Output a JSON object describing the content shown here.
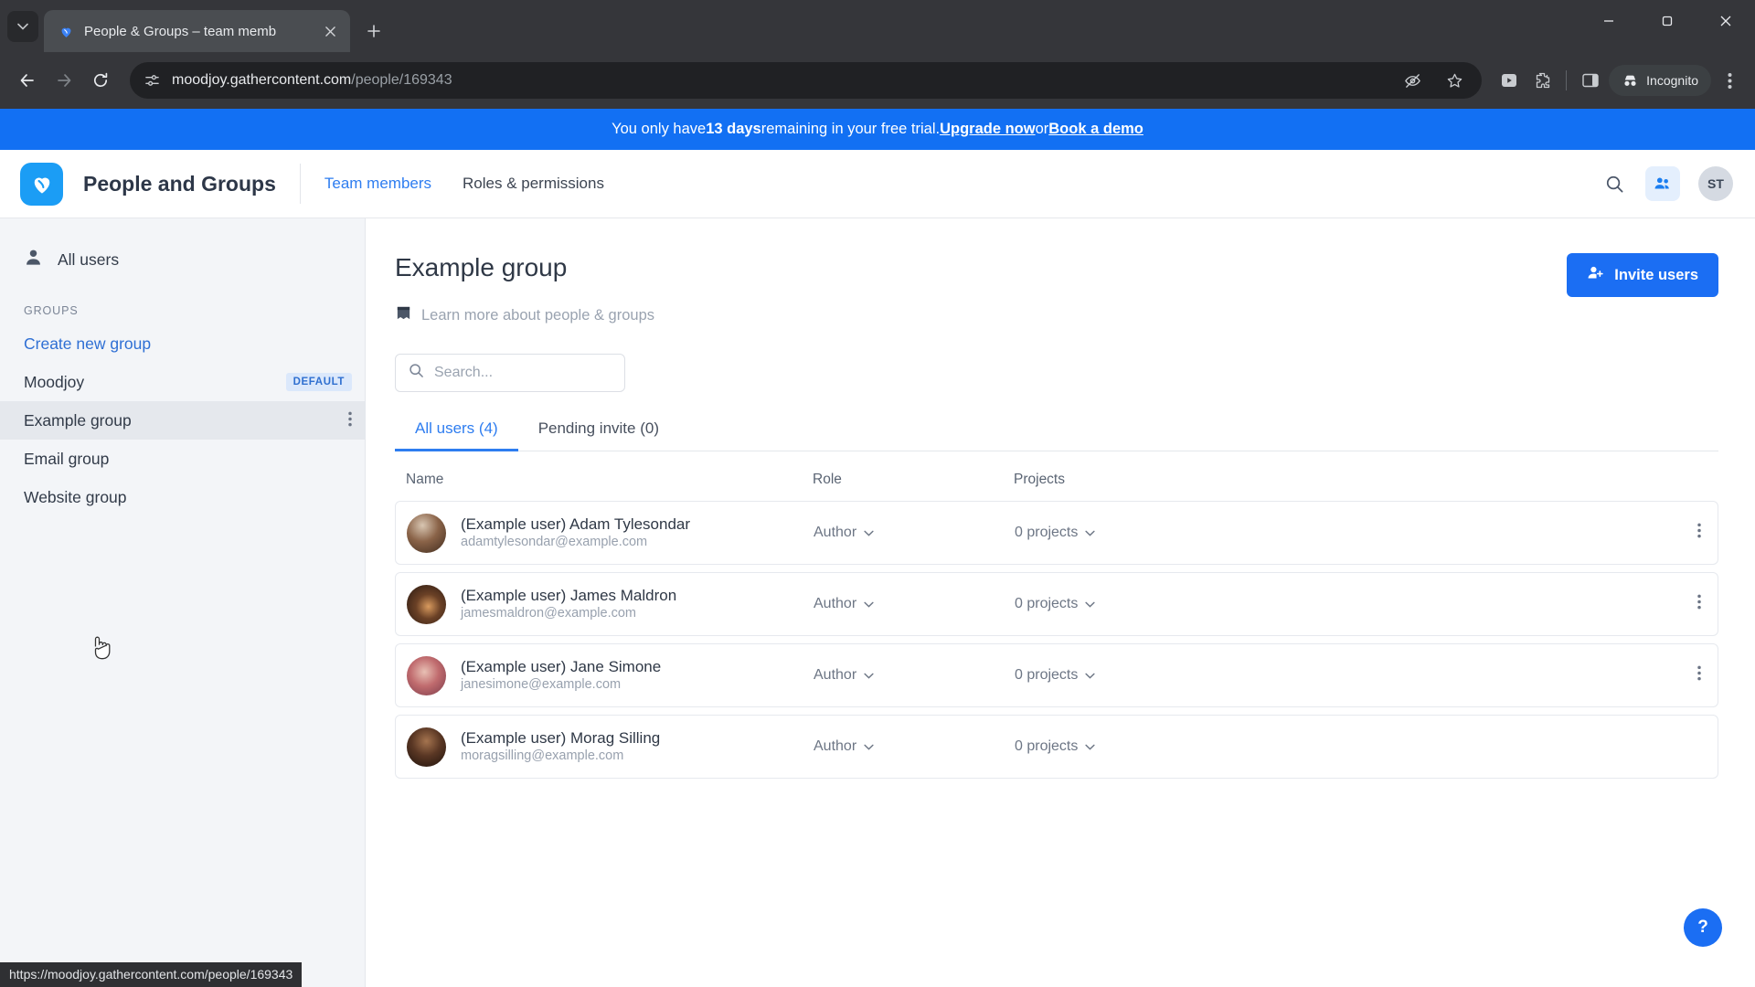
{
  "browser": {
    "tab": {
      "title": "People & Groups – team memb",
      "favicon": "gathercontent-heart-icon"
    },
    "url_host": "moodjoy.gathercontent.com",
    "url_path": "/people/169343",
    "profile_label": "Incognito",
    "status_bar_url": "https://moodjoy.gathercontent.com/people/169343",
    "icons": {
      "tab_search": "tab-list-icon",
      "new_tab": "+",
      "minimize": "–",
      "maximize": "❐",
      "close": "✕",
      "back": "back-arrow-icon",
      "forward": "forward-arrow-icon",
      "reload": "reload-icon",
      "site_info": "site-settings-icon",
      "tracking": "eye-off-icon",
      "bookmark": "star-icon",
      "extension_puzzle": "extensions-icon",
      "side_panel": "side-panel-icon",
      "menu": "three-dot-menu-icon"
    }
  },
  "banner": {
    "prefix": "You only have ",
    "days": "13 days",
    "middle": " remaining in your free trial. ",
    "link_upgrade": "Upgrade now",
    "conjunction": " or ",
    "link_demo": "Book a demo",
    "bg_color": "#1270f3"
  },
  "header": {
    "app_title": "People and Groups",
    "nav": [
      {
        "label": "Team members",
        "active": true
      },
      {
        "label": "Roles & permissions",
        "active": false
      }
    ],
    "search_icon": "search-icon",
    "groups_icon": "people-group-icon",
    "avatar_initials": "ST"
  },
  "sidebar": {
    "all_users": {
      "label": "All users",
      "icon": "user-icon"
    },
    "section_label": "GROUPS",
    "items": [
      {
        "label": "Create new group",
        "kind": "link",
        "badge": "",
        "active": false
      },
      {
        "label": "Moodjoy",
        "kind": "group",
        "badge": "DEFAULT",
        "active": false
      },
      {
        "label": "Example group",
        "kind": "group",
        "badge": "",
        "active": true
      },
      {
        "label": "Email group",
        "kind": "group",
        "badge": "",
        "active": false
      },
      {
        "label": "Website group",
        "kind": "group",
        "badge": "",
        "active": false
      }
    ]
  },
  "main": {
    "title": "Example group",
    "learn_more": {
      "label": "Learn more about people & groups",
      "icon": "book-icon"
    },
    "invite_button": {
      "label": "Invite users",
      "icon": "add-user-icon",
      "color": "#1b6ef3"
    },
    "search": {
      "placeholder": "Search...",
      "value": "",
      "icon": "search-icon"
    },
    "tabs": [
      {
        "label": "All users (4)",
        "active": true
      },
      {
        "label": "Pending invite (0)",
        "active": false
      }
    ],
    "table": {
      "columns": [
        "Name",
        "Role",
        "Projects"
      ],
      "rows": [
        {
          "name": "(Example user) Adam Tylesondar",
          "email": "adamtylesondar@example.com",
          "role": "Author",
          "projects": "0 projects",
          "avatar_color_a": "#c8b8a6",
          "avatar_color_b": "#5d4334"
        },
        {
          "name": "(Example user) James Maldron",
          "email": "jamesmaldron@example.com",
          "role": "Author",
          "projects": "0 projects",
          "avatar_color_a": "#3b2b22",
          "avatar_color_b": "#c9996a"
        },
        {
          "name": "(Example user) Jane Simone",
          "email": "janesimone@example.com",
          "role": "Author",
          "projects": "0 projects",
          "avatar_color_a": "#b98f86",
          "avatar_color_b": "#d94a5a"
        },
        {
          "name": "(Example user) Morag Silling",
          "email": "moragsilling@example.com",
          "role": "Author",
          "projects": "0 projects",
          "avatar_color_a": "#6a4a38",
          "avatar_color_b": "#2d1d16"
        }
      ]
    },
    "help_fab": "?"
  }
}
